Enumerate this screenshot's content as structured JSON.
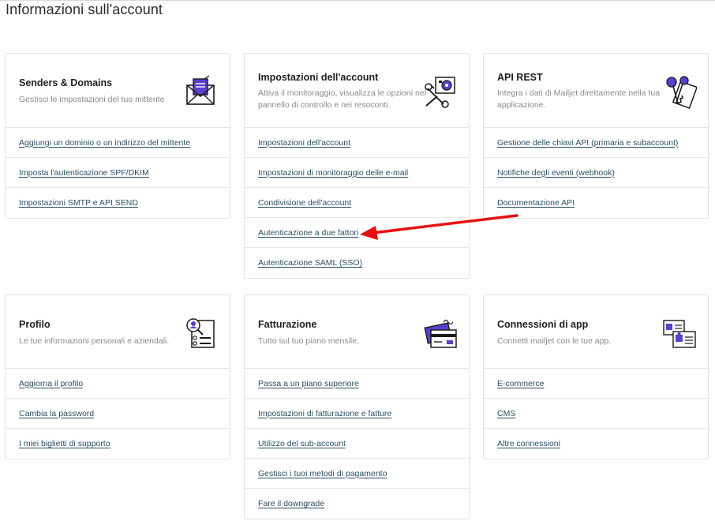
{
  "page": {
    "title": "Informazioni sull'account"
  },
  "cards": {
    "senders": {
      "title": "Senders & Domains",
      "description": "Gestisci le impostazioni del tuo mittente",
      "icon": "envelope-icon",
      "links": [
        "Aggiungi un dominio o un indirizzo del mittente",
        "Imposta l'autenticazione SPF/DKIM",
        "Impostazioni SMTP e API SEND"
      ]
    },
    "account": {
      "title": "Impostazioni dell'account",
      "description": "Attiva il monitoraggio, visualizza le opzioni nel pannello di controllo e nei resoconti.",
      "icon": "settings-tools-icon",
      "links": [
        "Impostazioni dell'account",
        "Impostazioni di monitoraggio delle e-mail",
        "Condivisione dell'account",
        "Autenticazione a due fattori",
        "Autenticazione SAML (SSO)"
      ]
    },
    "api": {
      "title": "API REST",
      "description": "Integra i dati di Mailjet direttamente nella tua applicazione.",
      "icon": "keys-icon",
      "links": [
        "Gestione delle chiavi API (primaria e subaccount)",
        "Notifiche degli eventi (webhook)",
        "Documentazione API"
      ]
    },
    "profile": {
      "title": "Profilo",
      "description": "Le tue informazioni personali e aziendali.",
      "icon": "profile-search-icon",
      "links": [
        "Aggiorna il profilo",
        "Cambia la password",
        "I miei biglietti di supporto"
      ]
    },
    "billing": {
      "title": "Fatturazione",
      "description": "Tutto sul tuo piano mensile.",
      "icon": "credit-card-icon",
      "links": [
        "Passa a un piano superiore",
        "Impostazioni di fatturazione e fatture",
        "Utilizzo del sub-account",
        "Gestisci i tuoi metodi di pagamento",
        "Fare il downgrade"
      ]
    },
    "apps": {
      "title": "Connessioni di app",
      "description": "Connetti mailjet con le tue app.",
      "icon": "puzzle-cards-icon",
      "links": [
        "E-commerce",
        "CMS",
        "Altre connessioni"
      ]
    }
  },
  "colors": {
    "link": "#294f63",
    "accent_purple": "#5b3fd0",
    "annotation_arrow": "#e8110f"
  }
}
